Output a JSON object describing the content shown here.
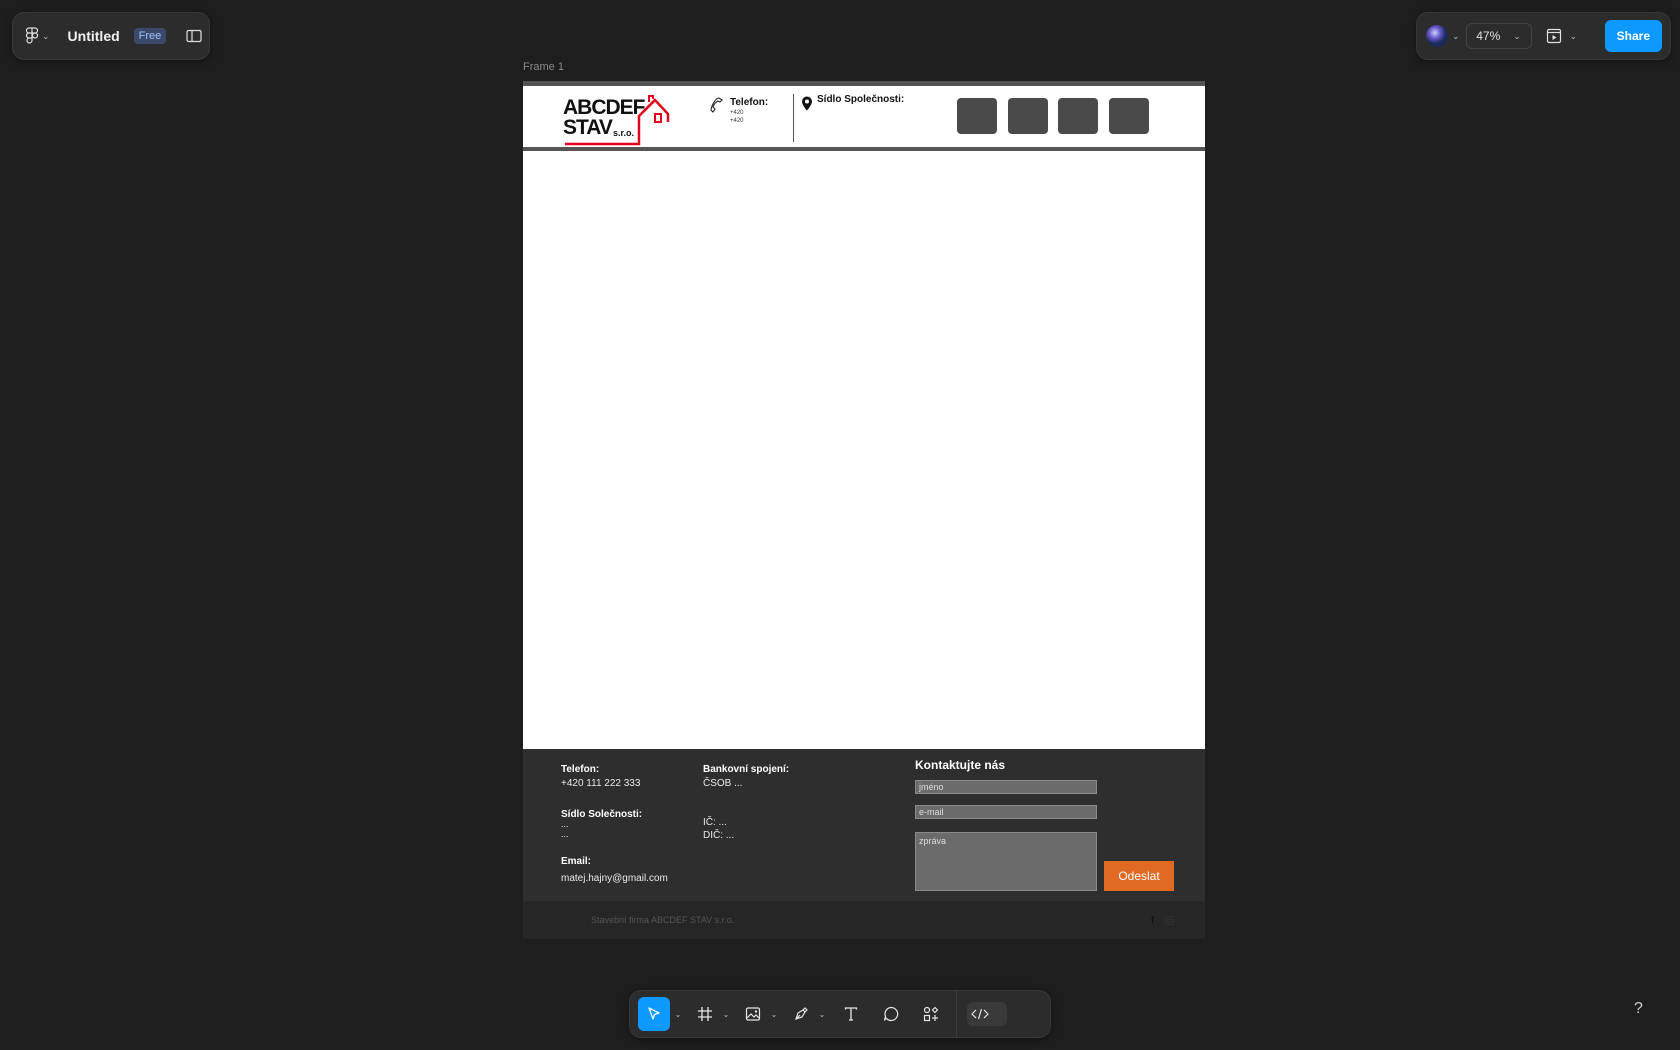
{
  "app": {
    "file_title": "Untitled",
    "plan_badge": "Free",
    "zoom": "47%",
    "share_label": "Share",
    "frame_label": "Frame 1",
    "help_label": "?"
  },
  "header": {
    "logo_line1": "ABCDEF",
    "logo_line2": "STAV",
    "logo_suffix": "s.r.o.",
    "phone_title": "Telefon:",
    "phone_lines": [
      "+420",
      "+420"
    ],
    "seat_title": "Sídlo Společnosti:"
  },
  "footer": {
    "phone_label": "Telefon:",
    "phone_value": "+420 111 222 333",
    "seat_label": "Sídlo Solečnosti:",
    "seat_lines": [
      "...",
      "..."
    ],
    "email_label": "Email:",
    "email_value": "matej.hajny@gmail.com",
    "bank_label": "Bankovní spojení:",
    "bank_value": "ČSOB ...",
    "ic": "IČ: ...",
    "dic": "DIČ: ...",
    "contact_title": "Kontaktujte nás",
    "name_placeholder": "jméno",
    "email_placeholder": "e-mail",
    "message_placeholder": "zpráva",
    "send_label": "Odeslat",
    "copyright": "Stavební firma ABCDEF STAV s.r.o."
  },
  "colors": {
    "canvas": "#1e1e1e",
    "accent": "#0d99ff",
    "send_button": "#e06a24",
    "footer_bg": "#2e2e2e",
    "logo_red": "#e3001b"
  },
  "toolbar": {
    "tools": [
      "move-tool",
      "frame-tool",
      "image-tool",
      "pen-tool",
      "text-tool",
      "comment-tool",
      "actions-tool",
      "dev-mode-toggle"
    ]
  }
}
